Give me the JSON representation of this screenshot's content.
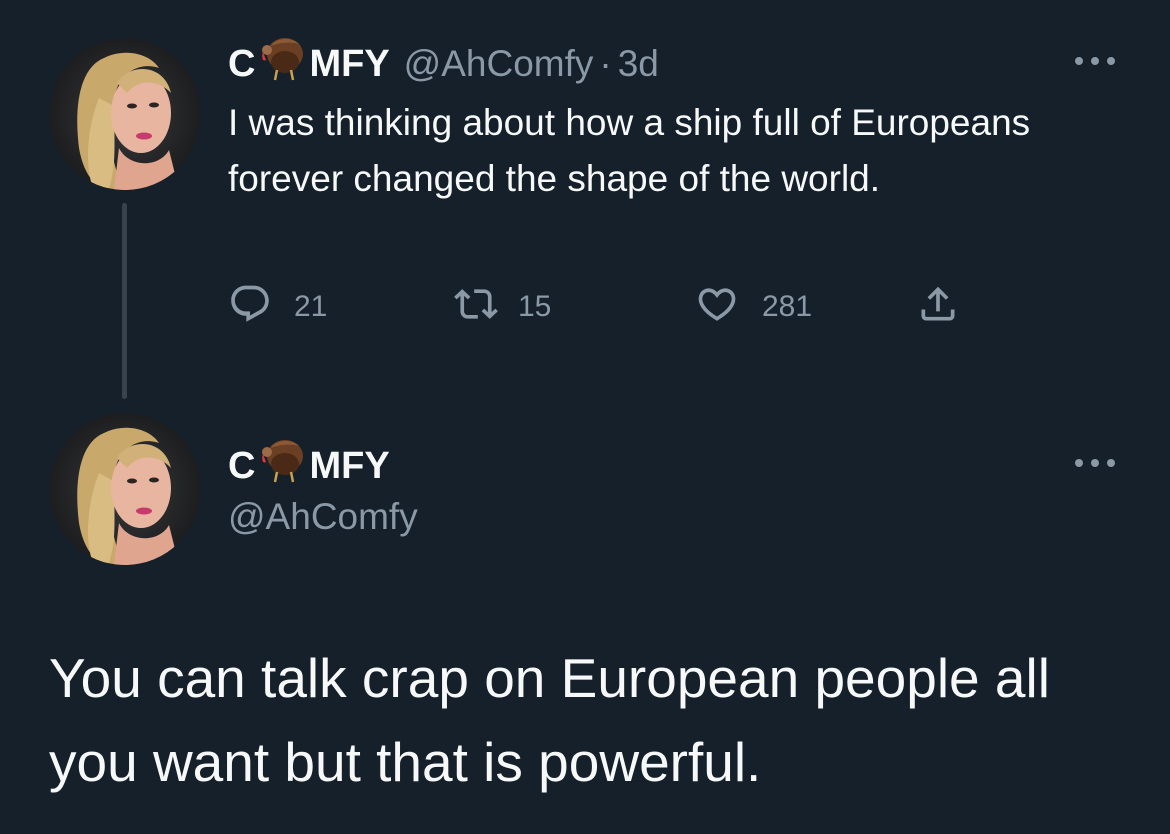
{
  "tweet": {
    "display_name_prefix": "C",
    "display_name_suffix": "MFY",
    "handle": "@AhComfy",
    "separator": "·",
    "time": "3d",
    "text": "I was thinking about how a ship full of Europeans forever changed the shape of the world.",
    "replies": "21",
    "retweets": "15",
    "likes": "281"
  },
  "reply": {
    "display_name_prefix": "C",
    "display_name_suffix": "MFY",
    "handle": "@AhComfy",
    "text": "You can talk crap on European people all you want but that is powerful."
  },
  "icons": {
    "avatar": "profile-photo",
    "name_emoji": "turkey-icon",
    "more": "more-dots-icon",
    "reply": "reply-icon",
    "retweet": "retweet-icon",
    "like": "heart-icon",
    "share": "share-icon"
  },
  "colors": {
    "background": "#15202b",
    "primary_text": "#f7f9f9",
    "secondary_text": "#8b98a5",
    "thread_line": "#38444d"
  }
}
